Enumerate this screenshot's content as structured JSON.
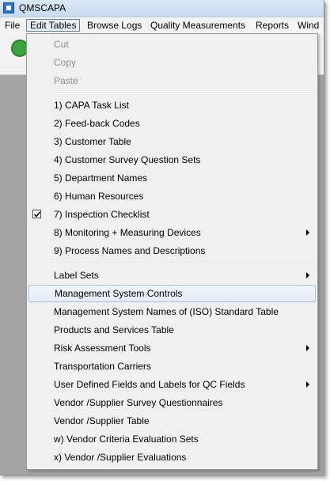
{
  "window": {
    "title": "QMSCAPA"
  },
  "menubar": {
    "items": [
      "File",
      "Edit Tables",
      "Browse Logs",
      "Quality Measurements",
      "Reports",
      "Wind"
    ]
  },
  "dropdown": {
    "items": [
      {
        "label": "Cut",
        "disabled": true
      },
      {
        "label": "Copy",
        "disabled": true
      },
      {
        "label": "Paste",
        "disabled": true
      },
      {
        "label": "1) CAPA Task List"
      },
      {
        "label": "2) Feed-back Codes"
      },
      {
        "label": "3) Customer Table"
      },
      {
        "label": "4) Customer Survey Question Sets"
      },
      {
        "label": "5) Department Names"
      },
      {
        "label": "6) Human Resources"
      },
      {
        "label": "7) Inspection Checklist",
        "checked": true
      },
      {
        "label": "8) Monitoring + Measuring Devices",
        "submenu": true
      },
      {
        "label": "9) Process Names and Descriptions"
      },
      {
        "label": "Label Sets",
        "submenu": true
      },
      {
        "label": "Management System Controls",
        "highlighted": true
      },
      {
        "label": "Management System Names of (ISO) Standard Table"
      },
      {
        "label": "Products and Services Table"
      },
      {
        "label": "Risk Assessment Tools",
        "submenu": true
      },
      {
        "label": "Transportation Carriers"
      },
      {
        "label": "User Defined Fields and Labels for QC Fields",
        "submenu": true
      },
      {
        "label": "Vendor /Supplier Survey Questionnaires"
      },
      {
        "label": "Vendor /Supplier Table"
      },
      {
        "label": "w) Vendor Criteria Evaluation Sets"
      },
      {
        "label": "x) Vendor /Supplier Evaluations"
      }
    ]
  }
}
